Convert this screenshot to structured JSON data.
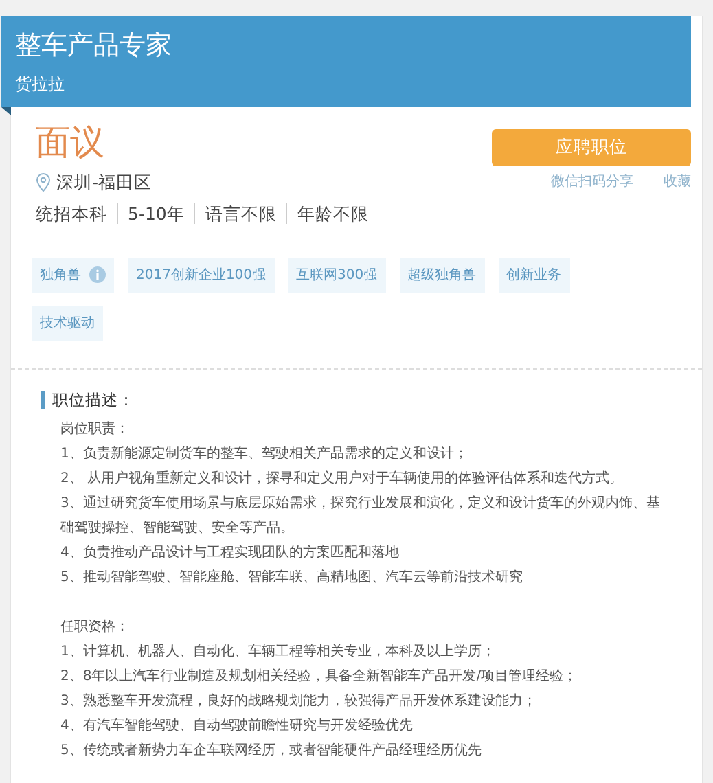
{
  "header": {
    "title": "整车产品专家",
    "company": "货拉拉"
  },
  "salary": "面议",
  "location": "深圳-福田区",
  "requirements": [
    "统招本科",
    "5-10年",
    "语言不限",
    "年龄不限"
  ],
  "apply_button": "应聘职位",
  "links": [
    "微信扫码分享",
    "收藏"
  ],
  "tags": [
    {
      "label": "独角兽",
      "has_info": true
    },
    {
      "label": "2017创新企业100强",
      "has_info": false
    },
    {
      "label": "互联网300强",
      "has_info": false
    },
    {
      "label": "超级独角兽",
      "has_info": false
    },
    {
      "label": "创新业务",
      "has_info": false
    },
    {
      "label": "技术驱动",
      "has_info": false
    }
  ],
  "description": {
    "heading": "职位描述：",
    "sections": [
      {
        "title": "岗位职责：",
        "items": [
          "1、负责新能源定制货车的整车、驾驶相关产品需求的定义和设计；",
          "2、 从用户视角重新定义和设计，探寻和定义用户对于车辆使用的体验评估体系和迭代方式。",
          "3、通过研究货车使用场景与底层原始需求，探究行业发展和演化，定义和设计货车的外观内饰、基础驾驶操控、智能驾驶、安全等产品。",
          "4、负责推动产品设计与工程实现团队的方案匹配和落地",
          "5、推动智能驾驶、智能座舱、智能车联、高精地图、汽车云等前沿技术研究"
        ]
      },
      {
        "title": "任职资格：",
        "items": [
          "1、计算机、机器人、自动化、车辆工程等相关专业，本科及以上学历；",
          "2、8年以上汽车行业制造及规划相关经验，具备全新智能车产品开发/项目管理经验；",
          "3、熟悉整车开发流程，良好的战略规划能力，较强得产品开发体系建设能力；",
          "4、有汽车智能驾驶、自动驾驶前瞻性研究与开发经验优先",
          "5、传统或者新势力车企车联网经历，或者智能硬件产品经理经历优先"
        ]
      }
    ]
  }
}
